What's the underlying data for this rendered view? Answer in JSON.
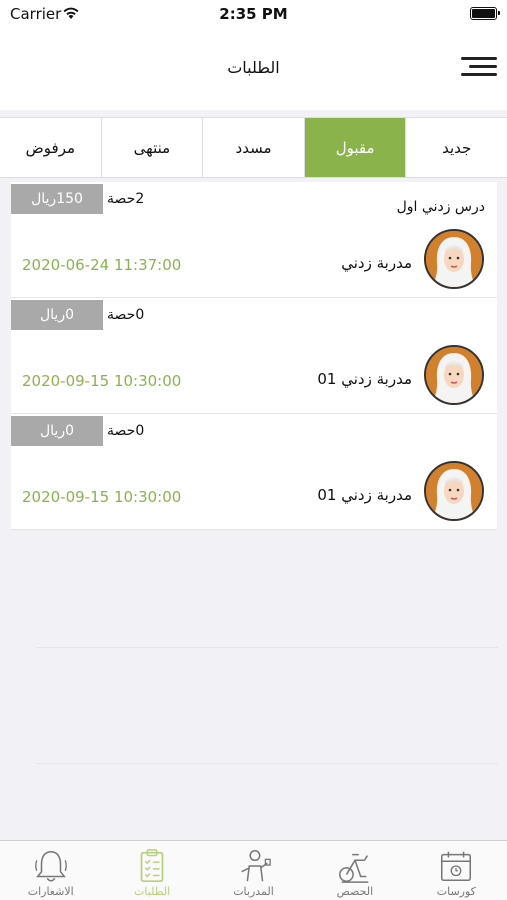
{
  "status_bar": {
    "carrier": "Carrier",
    "time": "2:35 PM"
  },
  "header": {
    "title": "الطلبات"
  },
  "tabs": [
    {
      "label": "جديد",
      "active": false
    },
    {
      "label": "مقبول",
      "active": true
    },
    {
      "label": "مسدد",
      "active": false
    },
    {
      "label": "منتهى",
      "active": false
    },
    {
      "label": "مرفوض",
      "active": false
    }
  ],
  "orders": [
    {
      "price": "150ريال",
      "sessions": "2حصة",
      "course": "درس زدني اول",
      "trainer": "مدربة زدني",
      "date": "2020-06-24 11:37:00"
    },
    {
      "price": "0ريال",
      "sessions": "0حصة",
      "course": "",
      "trainer": "مدربة زدني 01",
      "date": "2020-09-15 10:30:00"
    },
    {
      "price": "0ريال",
      "sessions": "0حصة",
      "course": "",
      "trainer": "مدربة زدني 01",
      "date": "2020-09-15 10:30:00"
    }
  ],
  "tab_bar": [
    {
      "label": "كورسات",
      "icon": "calendar-icon",
      "active": false
    },
    {
      "label": "الحصص",
      "icon": "exercise-bike-icon",
      "active": false
    },
    {
      "label": "المدربات",
      "icon": "trainer-icon",
      "active": false
    },
    {
      "label": "الطلبات",
      "icon": "clipboard-list-icon",
      "active": true
    },
    {
      "label": "الاشعارات",
      "icon": "bell-icon",
      "active": false
    }
  ],
  "colors": {
    "accent": "#8bb34c",
    "badge": "#a9a9a9",
    "avatar_bg": "#d2802c",
    "tab_active": "#b9cf7c"
  }
}
